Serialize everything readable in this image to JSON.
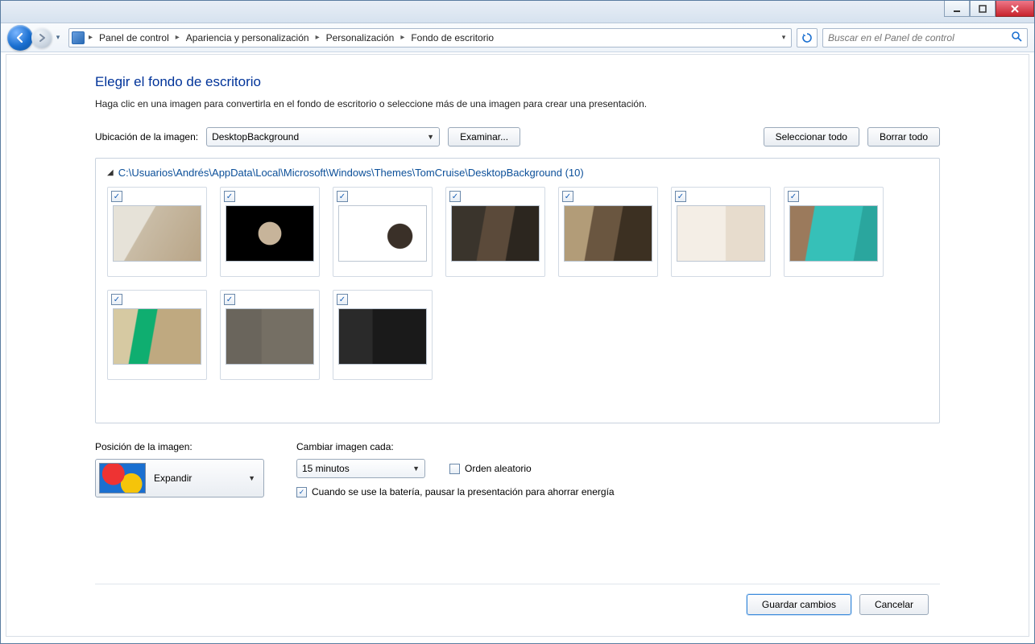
{
  "breadcrumbs": [
    "Panel de control",
    "Apariencia y personalización",
    "Personalización",
    "Fondo de escritorio"
  ],
  "search": {
    "placeholder": "Buscar en el Panel de control"
  },
  "page": {
    "title": "Elegir el fondo de escritorio",
    "subtitle": "Haga clic en una imagen para convertirla en el fondo de escritorio o seleccione más de una imagen para crear una presentación."
  },
  "location": {
    "label": "Ubicación de la imagen:",
    "value": "DesktopBackground",
    "browse": "Examinar...",
    "select_all": "Seleccionar todo",
    "clear_all": "Borrar todo"
  },
  "group": {
    "path": "C:\\Usuarios\\Andrés\\AppData\\Local\\Microsoft\\Windows\\Themes\\TomCruise\\DesktopBackground (10)"
  },
  "thumbs": [
    {
      "checked": true
    },
    {
      "checked": true
    },
    {
      "checked": true
    },
    {
      "checked": true
    },
    {
      "checked": true
    },
    {
      "checked": true
    },
    {
      "checked": true
    },
    {
      "checked": true
    },
    {
      "checked": true
    },
    {
      "checked": true
    }
  ],
  "position": {
    "label": "Posición de la imagen:",
    "value": "Expandir"
  },
  "interval": {
    "label": "Cambiar imagen cada:",
    "value": "15 minutos"
  },
  "shuffle": {
    "label": "Orden aleatorio",
    "checked": false
  },
  "battery": {
    "label": "Cuando se use la batería, pausar la presentación para ahorrar energía",
    "checked": true
  },
  "footer": {
    "save": "Guardar cambios",
    "cancel": "Cancelar"
  },
  "check_glyph": "✓"
}
